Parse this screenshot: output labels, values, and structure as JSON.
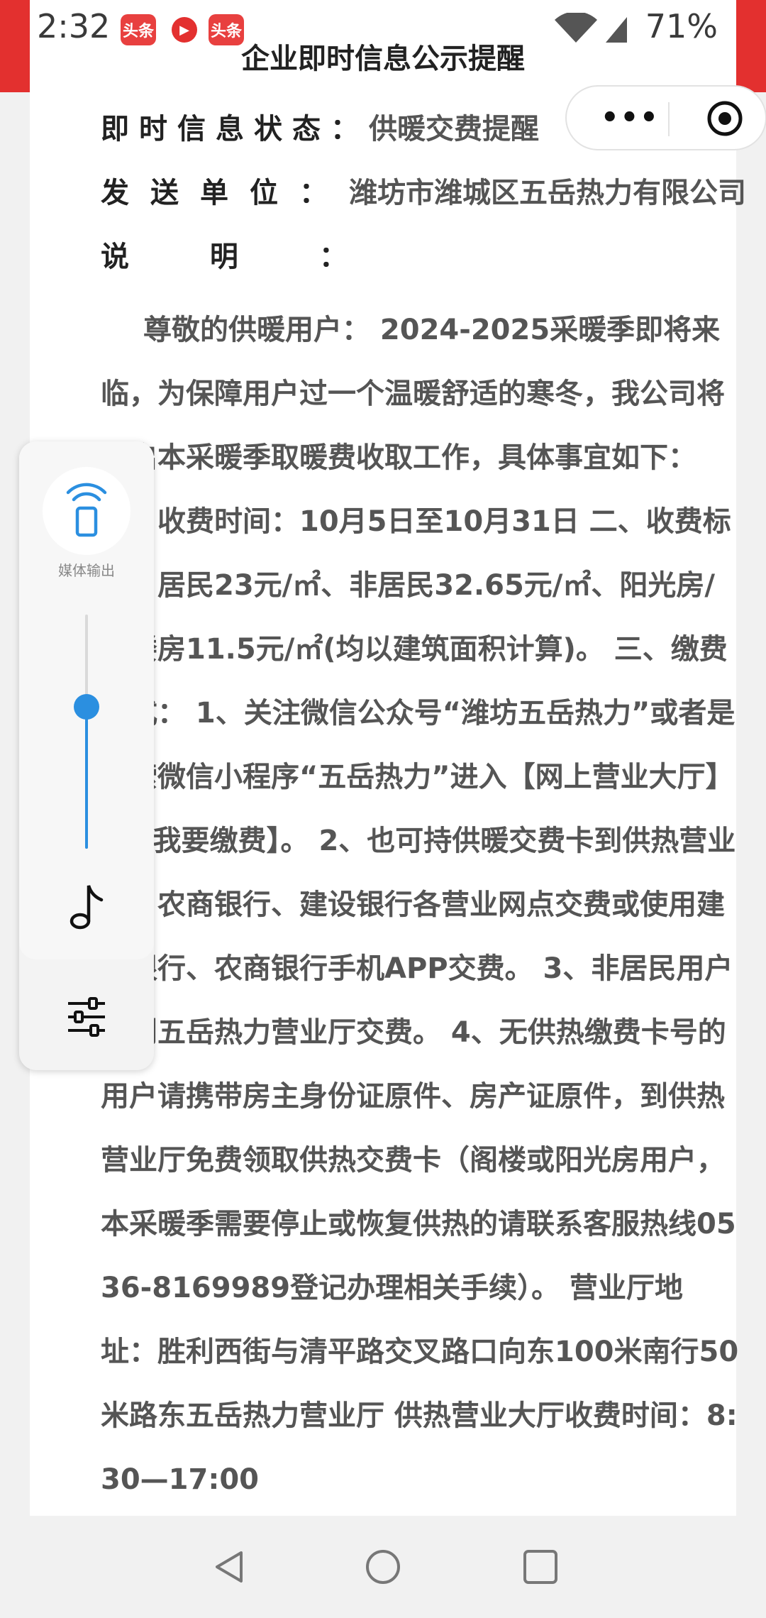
{
  "status_bar": {
    "time": "2:32",
    "app_badge_1": "头条",
    "app_badge_3": "头条",
    "battery": "71%"
  },
  "header": {
    "title": "企业即时信息公示提醒"
  },
  "fields": {
    "status_label": "即时信息状态：",
    "status_value": "供暖交费提醒",
    "sender_label": "发送单位：",
    "sender_value": "潍坊市潍城区五岳热力有限公司",
    "desc_label": "说 明 ："
  },
  "description": "尊敬的供暖用户： 2024-2025采暖季即将来临，为保障用户过一个温暖舒适的寒冬，我公司将开启本采暖季取暖费收取工作，具体事宜如下： 一、收费时间：10月5日至10月31日 二、收费标准：居民23元/㎡、非居民32.65元/㎡、阳光房/阁楼房11.5元/㎡(均以建筑面积计算)。 三、缴费方式： 1、关注微信公众号“潍坊五岳热力”或者是搜索微信小程序“五岳热力”进入【网上营业大厅】→【我要缴费】。 2、也可持供暖交费卡到供热营业厅、农商银行、建设银行各营业网点交费或使用建设银行、农商银行手机APP交费。 3、非居民用户请到五岳热力营业厅交费。 4、无供热缴费卡号的用户请携带房主身份证原件、房产证原件，到供热营业厅免费领取供热交费卡（阁楼或阳光房用户，本采暖季需要停止或恢复供热的请联系客服热线0536-8169989登记办理相关手续）。 营业厅地址：胜利西街与清平路交叉路口向东100米南行50米路东五岳热力营业厅 供热营业大厅收费时间：8:30—17:00",
  "media_panel": {
    "cast_label": "媒体输出",
    "volume_level": 0.62
  },
  "colors": {
    "accent": "#2b8fe0",
    "brand_red": "#e3302f"
  }
}
